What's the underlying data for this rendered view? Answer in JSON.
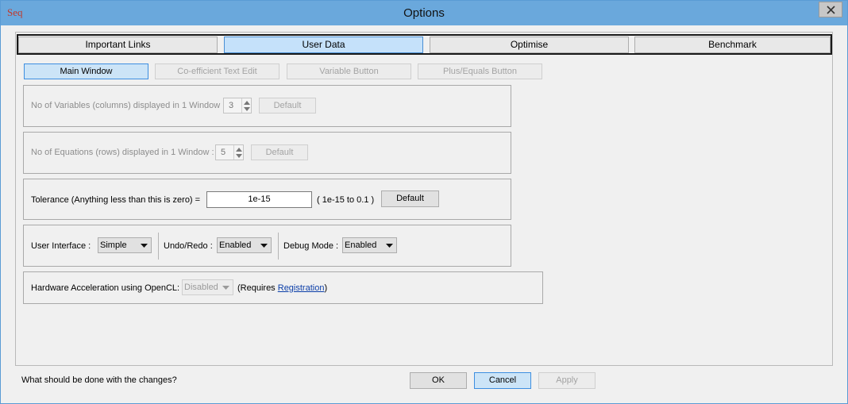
{
  "window": {
    "title": "Options",
    "app_icon_text": "Seq"
  },
  "tabs": [
    {
      "label": "Important Links",
      "active": false
    },
    {
      "label": "User Data",
      "active": true
    },
    {
      "label": "Optimise",
      "active": false
    },
    {
      "label": "Benchmark",
      "active": false
    }
  ],
  "sub_tabs": [
    {
      "label": "Main Window",
      "active": true
    },
    {
      "label": "Co-efficient Text Edit",
      "active": false
    },
    {
      "label": "Variable Button",
      "active": false
    },
    {
      "label": "Plus/Equals Button",
      "active": false
    }
  ],
  "variables": {
    "label": "No of Variables (columns) displayed in 1 Window :",
    "value": "3",
    "default_label": "Default"
  },
  "equations": {
    "label": "No of Equations (rows) displayed in 1 Window :",
    "value": "5",
    "default_label": "Default"
  },
  "tolerance": {
    "label": "Tolerance (Anything less than this is zero)  =",
    "value": "1e-15",
    "range": "( 1e-15 to 0.1 )",
    "default_label": "Default"
  },
  "settings": {
    "ui_label": "User Interface :",
    "ui_value": "Simple",
    "undo_label": "Undo/Redo :",
    "undo_value": "Enabled",
    "debug_label": "Debug Mode :",
    "debug_value": "Enabled"
  },
  "hardware": {
    "label": "Hardware Acceleration using OpenCL:",
    "value": "Disabled",
    "requires_prefix": "(Requires ",
    "registration_link": "Registration",
    "requires_suffix": ")"
  },
  "footer": {
    "question": "What should be done with the changes?",
    "ok": "OK",
    "cancel": "Cancel",
    "apply": "Apply"
  }
}
